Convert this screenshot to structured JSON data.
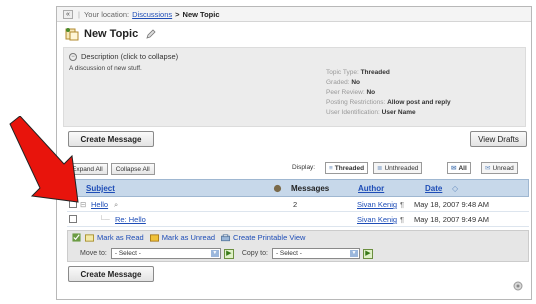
{
  "location": {
    "prefix": "Your location:",
    "link": "Discussions",
    "separator": ">",
    "current": "New Topic"
  },
  "title": {
    "text": "New Topic"
  },
  "description": {
    "header": "Description (click to collapse)",
    "text": "A discussion of new stuff.",
    "meta": [
      {
        "label": "Topic Type:",
        "value": "Threaded"
      },
      {
        "label": "Graded:",
        "value": "No"
      },
      {
        "label": "Peer Review:",
        "value": "No"
      },
      {
        "label": "Posting Restrictions:",
        "value": "Allow post and reply"
      },
      {
        "label": "User Identification:",
        "value": "User Name"
      }
    ]
  },
  "buttons": {
    "create_message": "Create Message",
    "view_drafts": "View Drafts",
    "expand_all": "Expand All",
    "collapse_all": "Collapse All"
  },
  "display": {
    "label": "Display:",
    "threaded": "Threaded",
    "unthreaded": "Unthreaded",
    "all": "All",
    "unread": "Unread"
  },
  "table": {
    "headers": {
      "subject": "Subject",
      "messages": "Messages",
      "author": "Author",
      "date": "Date"
    },
    "rows": [
      {
        "subject": "Hello",
        "messages": "2",
        "author": "Sivan Kenig",
        "date": "May 18, 2007 9:48 AM"
      },
      {
        "subject": "Re: Hello",
        "messages": "",
        "author": "Sivan Kenig",
        "date": "May 18, 2007 9:49 AM"
      }
    ]
  },
  "actions": {
    "mark_read": "Mark as Read",
    "mark_unread": "Mark as Unread",
    "printable": "Create Printable View",
    "move_to": "Move to:",
    "copy_to": "Copy to:",
    "select_placeholder": "- Select -"
  },
  "colors": {
    "link": "#1e4db7",
    "header_bg": "#c7d8ea",
    "arrow": "#e8140c"
  }
}
